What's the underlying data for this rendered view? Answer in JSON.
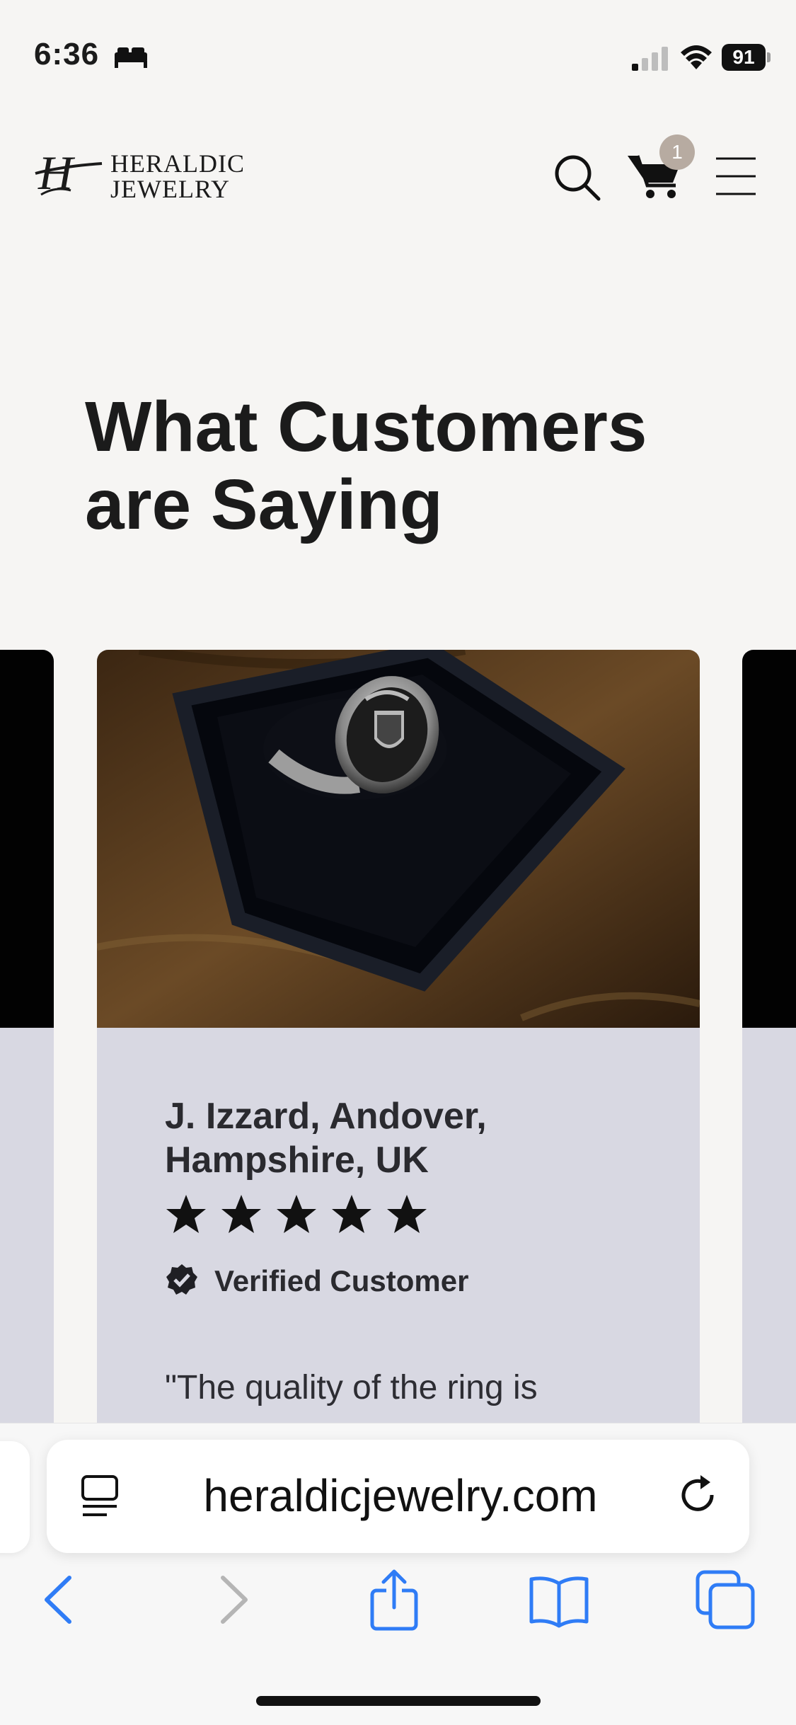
{
  "status_bar": {
    "time": "6:36",
    "battery": "91"
  },
  "header": {
    "logo_line1": "HERALDIC",
    "logo_line2": "JEWELRY",
    "cart_count": "1"
  },
  "section": {
    "title": "What Customers are Saying"
  },
  "review": {
    "reviewer": "J. Izzard, Andover, Hampshire, UK",
    "rating": 5,
    "verified_label": "Verified Customer",
    "quote_start": "\"The quality of the ring is"
  },
  "browser": {
    "url": "heraldicjewelry.com"
  },
  "colors": {
    "page_bg": "#f6f5f3",
    "card_bg": "#d8d8e2",
    "badge": "#b7aba1",
    "ios_blue": "#2f7cf6"
  }
}
